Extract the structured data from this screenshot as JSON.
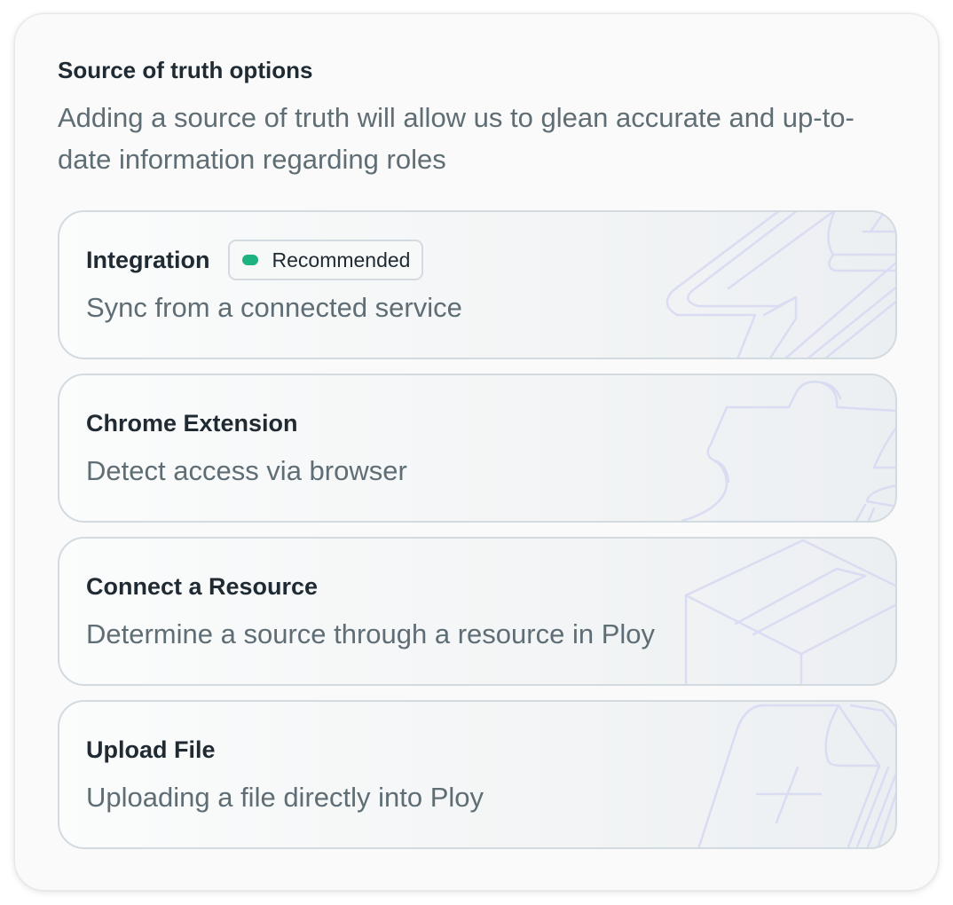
{
  "header": {
    "title": "Source of truth options",
    "subtitle": "Adding a source of truth will allow us to glean accurate and up-to-date information regarding roles"
  },
  "options": [
    {
      "title": "Integration",
      "badge": "Recommended",
      "description": "Sync from a connected service",
      "icon": "lightning-icon"
    },
    {
      "title": "Chrome Extension",
      "description": "Detect access via browser",
      "icon": "puzzle-icon"
    },
    {
      "title": "Connect a Resource",
      "description": "Determine a source through a resource in Ploy",
      "icon": "box-icon"
    },
    {
      "title": "Upload File",
      "description": "Uploading a file directly into Ploy",
      "icon": "file-plus-icon"
    }
  ],
  "colors": {
    "badge_dot": "#1db27f",
    "title_text": "#1f2a33",
    "body_text": "#5f6d75",
    "card_border": "#d3dbe0",
    "icon_stroke": "#d9dcf2"
  }
}
